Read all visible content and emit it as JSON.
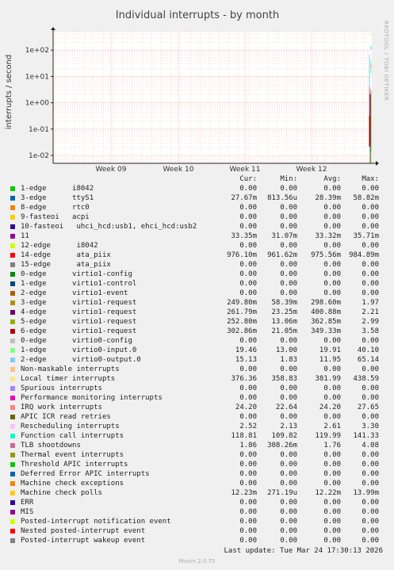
{
  "chart_data": {
    "type": "line",
    "title": "Individual interrupts - by month",
    "ylabel": "interrupts / second",
    "y_scale": "log",
    "ylim": [
      0.005,
      500
    ],
    "y_ticks": [
      {
        "value": 100,
        "label": "1e+02"
      },
      {
        "value": 10,
        "label": "1e+01"
      },
      {
        "value": 1,
        "label": "1e+00"
      },
      {
        "value": 0.1,
        "label": "1e-01"
      },
      {
        "value": 0.01,
        "label": "1e-02"
      }
    ],
    "x_ticks": [
      "Week 09",
      "Week 10",
      "Week 11",
      "Week 12"
    ],
    "grid": true,
    "side_text": "RRDTOOL / TOBI OETIKER",
    "legend_headers": {
      "cur": "Cur:",
      "min": "Min:",
      "avg": "Avg:",
      "max": "Max:"
    },
    "series": [
      {
        "label": "1-edge      i8042",
        "color": "#00cc00",
        "cur": "0.00",
        "min": "0.00",
        "avg": "0.00",
        "max": "0.00"
      },
      {
        "label": "3-edge      ttyS1",
        "color": "#0066b3",
        "cur": "27.67m",
        "min": "813.56u",
        "avg": "28.39m",
        "max": "58.82m"
      },
      {
        "label": "8-edge      rtc0",
        "color": "#ff8000",
        "cur": "0.00",
        "min": "0.00",
        "avg": "0.00",
        "max": "0.00"
      },
      {
        "label": "9-fasteoi   acpi",
        "color": "#ffcc00",
        "cur": "0.00",
        "min": "0.00",
        "avg": "0.00",
        "max": "0.00"
      },
      {
        "label": "10-fasteoi   uhci_hcd:usb1, ehci_hcd:usb2",
        "color": "#330099",
        "cur": "0.00",
        "min": "0.00",
        "avg": "0.00",
        "max": "0.00"
      },
      {
        "label": "11",
        "color": "#990099",
        "cur": "33.35m",
        "min": "31.07m",
        "avg": "33.32m",
        "max": "35.71m"
      },
      {
        "label": "12-edge      i8042",
        "color": "#ccff00",
        "cur": "0.00",
        "min": "0.00",
        "avg": "0.00",
        "max": "0.00"
      },
      {
        "label": "14-edge      ata_piix",
        "color": "#ff0000",
        "cur": "976.10m",
        "min": "961.62m",
        "avg": "975.56m",
        "max": "984.89m"
      },
      {
        "label": "15-edge      ata_piix",
        "color": "#808080",
        "cur": "0.00",
        "min": "0.00",
        "avg": "0.00",
        "max": "0.00"
      },
      {
        "label": "0-edge      virtio1-config",
        "color": "#008f00",
        "cur": "0.00",
        "min": "0.00",
        "avg": "0.00",
        "max": "0.00"
      },
      {
        "label": "1-edge      virtio1-control",
        "color": "#00487d",
        "cur": "0.00",
        "min": "0.00",
        "avg": "0.00",
        "max": "0.00"
      },
      {
        "label": "2-edge      virtio1-event",
        "color": "#b35a00",
        "cur": "0.00",
        "min": "0.00",
        "avg": "0.00",
        "max": "0.00"
      },
      {
        "label": "3-edge      virtio1-request",
        "color": "#b38f00",
        "cur": "249.80m",
        "min": "58.39m",
        "avg": "298.60m",
        "max": "1.97"
      },
      {
        "label": "4-edge      virtio1-request",
        "color": "#6b006b",
        "cur": "261.79m",
        "min": "23.25m",
        "avg": "400.88m",
        "max": "2.21"
      },
      {
        "label": "5-edge      virtio1-request",
        "color": "#8fb300",
        "cur": "252.80m",
        "min": "13.06m",
        "avg": "362.85m",
        "max": "2.99"
      },
      {
        "label": "6-edge      virtio1-request",
        "color": "#b30000",
        "cur": "302.86m",
        "min": "21.05m",
        "avg": "349.33m",
        "max": "3.58"
      },
      {
        "label": "0-edge      virtio0-config",
        "color": "#bebebe",
        "cur": "0.00",
        "min": "0.00",
        "avg": "0.00",
        "max": "0.00"
      },
      {
        "label": "1-edge      virtio0-input.0",
        "color": "#80ff80",
        "cur": "19.46",
        "min": "13.00",
        "avg": "19.91",
        "max": "40.10"
      },
      {
        "label": "2-edge      virtio0-output.0",
        "color": "#80c9ff",
        "cur": "15.13",
        "min": "1.83",
        "avg": "11.95",
        "max": "65.14"
      },
      {
        "label": "Non-maskable interrupts",
        "color": "#ffc080",
        "cur": "0.00",
        "min": "0.00",
        "avg": "0.00",
        "max": "0.00"
      },
      {
        "label": "Local timer interrupts",
        "color": "#ffe680",
        "cur": "376.36",
        "min": "358.83",
        "avg": "381.99",
        "max": "438.59"
      },
      {
        "label": "Spurious interrupts",
        "color": "#aa80ff",
        "cur": "0.00",
        "min": "0.00",
        "avg": "0.00",
        "max": "0.00"
      },
      {
        "label": "Performance monitoring interrupts",
        "color": "#ee00cc",
        "cur": "0.00",
        "min": "0.00",
        "avg": "0.00",
        "max": "0.00"
      },
      {
        "label": "IRQ work interrupts",
        "color": "#ff8080",
        "cur": "24.20",
        "min": "22.64",
        "avg": "24.20",
        "max": "27.65"
      },
      {
        "label": "APIC ICR read retries",
        "color": "#666600",
        "cur": "0.00",
        "min": "0.00",
        "avg": "0.00",
        "max": "0.00"
      },
      {
        "label": "Rescheduling interrupts",
        "color": "#ffbfff",
        "cur": "2.52",
        "min": "2.13",
        "avg": "2.61",
        "max": "3.30"
      },
      {
        "label": "Function call interrupts",
        "color": "#00ffcc",
        "cur": "118.81",
        "min": "109.82",
        "avg": "119.99",
        "max": "141.33"
      },
      {
        "label": "TLB shootdowns",
        "color": "#cc6699",
        "cur": "1.86",
        "min": "308.26m",
        "avg": "1.76",
        "max": "4.08"
      },
      {
        "label": "Thermal event interrupts",
        "color": "#999900",
        "cur": "0.00",
        "min": "0.00",
        "avg": "0.00",
        "max": "0.00"
      },
      {
        "label": "Threshold APIC interrupts",
        "color": "#00cc00",
        "cur": "0.00",
        "min": "0.00",
        "avg": "0.00",
        "max": "0.00"
      },
      {
        "label": "Deferred Error APIC interrupts",
        "color": "#0066b3",
        "cur": "0.00",
        "min": "0.00",
        "avg": "0.00",
        "max": "0.00"
      },
      {
        "label": "Machine check exceptions",
        "color": "#ff8000",
        "cur": "0.00",
        "min": "0.00",
        "avg": "0.00",
        "max": "0.00"
      },
      {
        "label": "Machine check polls",
        "color": "#ffcc00",
        "cur": "12.23m",
        "min": "271.19u",
        "avg": "12.22m",
        "max": "13.99m"
      },
      {
        "label": "ERR",
        "color": "#330099",
        "cur": "0.00",
        "min": "0.00",
        "avg": "0.00",
        "max": "0.00"
      },
      {
        "label": "MIS",
        "color": "#990099",
        "cur": "0.00",
        "min": "0.00",
        "avg": "0.00",
        "max": "0.00"
      },
      {
        "label": "Posted-interrupt notification event",
        "color": "#ccff00",
        "cur": "0.00",
        "min": "0.00",
        "avg": "0.00",
        "max": "0.00"
      },
      {
        "label": "Nested posted-interrupt event",
        "color": "#ff0000",
        "cur": "0.00",
        "min": "0.00",
        "avg": "0.00",
        "max": "0.00"
      },
      {
        "label": "Posted-interrupt wakeup event",
        "color": "#808080",
        "cur": "0.00",
        "min": "0.00",
        "avg": "0.00",
        "max": "0.00"
      }
    ]
  },
  "footer": {
    "last_update": "Last update: Tue Mar 24 17:30:13 2026",
    "version": "Munin 2.0.75"
  }
}
